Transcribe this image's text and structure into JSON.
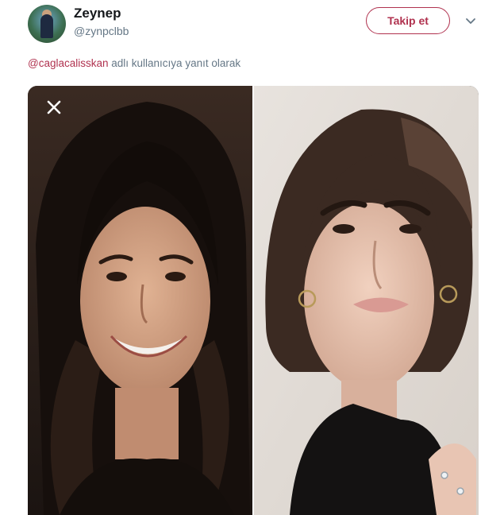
{
  "author": {
    "display_name": "Zeynep",
    "handle": "@zynpclbb"
  },
  "follow_button": {
    "label": "Takip et"
  },
  "reply_context": {
    "mention": "@caglacalisskan",
    "suffix": " adlı kullanıcıya yanıt olarak"
  },
  "media": {
    "description_left": "before-photo",
    "description_right": "after-photo"
  },
  "icons": {
    "caret": "chevron-down-icon",
    "close": "close-icon"
  },
  "colors": {
    "accent": "#b0324f",
    "secondary_text": "#657786"
  }
}
